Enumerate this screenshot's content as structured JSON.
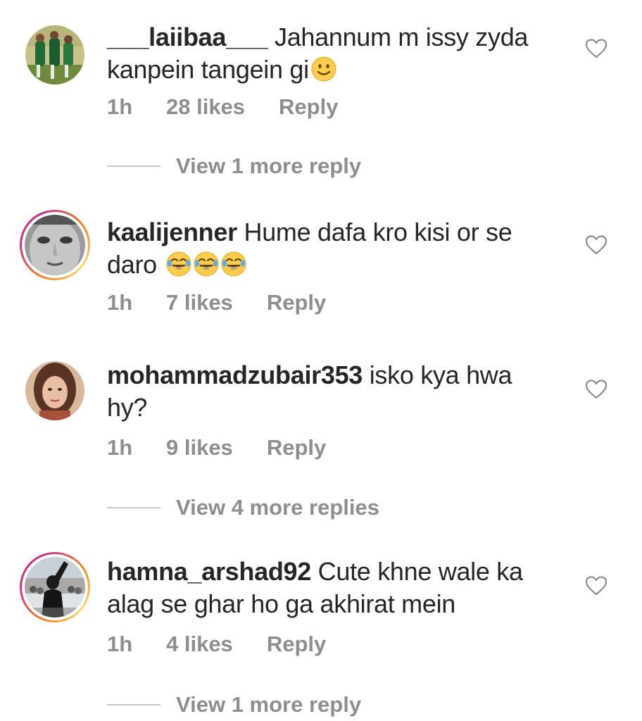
{
  "comments": [
    {
      "username": "___laiibaa___",
      "text_line1": "Jahannum m issy zyda",
      "text_line2": "kanpein tangein gi",
      "emoji": "slightly-smiling-face",
      "time": "1h",
      "likes": "28 likes",
      "reply": "Reply",
      "view_more": "View 1 more reply",
      "avatar": "cricket-team-avatar",
      "story_ring": false
    },
    {
      "username": "kaalijenner",
      "text_line1": "Hume dafa kro kisi or se",
      "text_line2": "daro",
      "emoji": "face-with-tears-of-joy",
      "emoji_count": 3,
      "time": "1h",
      "likes": "7 likes",
      "reply": "Reply",
      "view_more": "",
      "avatar": "grayscale-face-avatar",
      "story_ring": true
    },
    {
      "username": "mohammadzubair353",
      "text_line1": "isko kya hwa",
      "text_line2": "hy?",
      "time": "1h",
      "likes": "9 likes",
      "reply": "Reply",
      "view_more": "View 4 more replies",
      "avatar": "woman-portrait-avatar",
      "story_ring": false
    },
    {
      "username": "hamna_arshad92",
      "text_line1": "Cute khne wale ka",
      "text_line2": "alag se ghar ho ga akhirat mein",
      "time": "1h",
      "likes": "4 likes",
      "reply": "Reply",
      "view_more": "View 1 more reply",
      "avatar": "woman-in-black-avatar",
      "story_ring": true
    }
  ],
  "colors": {
    "text": "#262626",
    "secondary": "#8e8e8e",
    "divider": "#c7c7c7",
    "background": "#ffffff"
  }
}
